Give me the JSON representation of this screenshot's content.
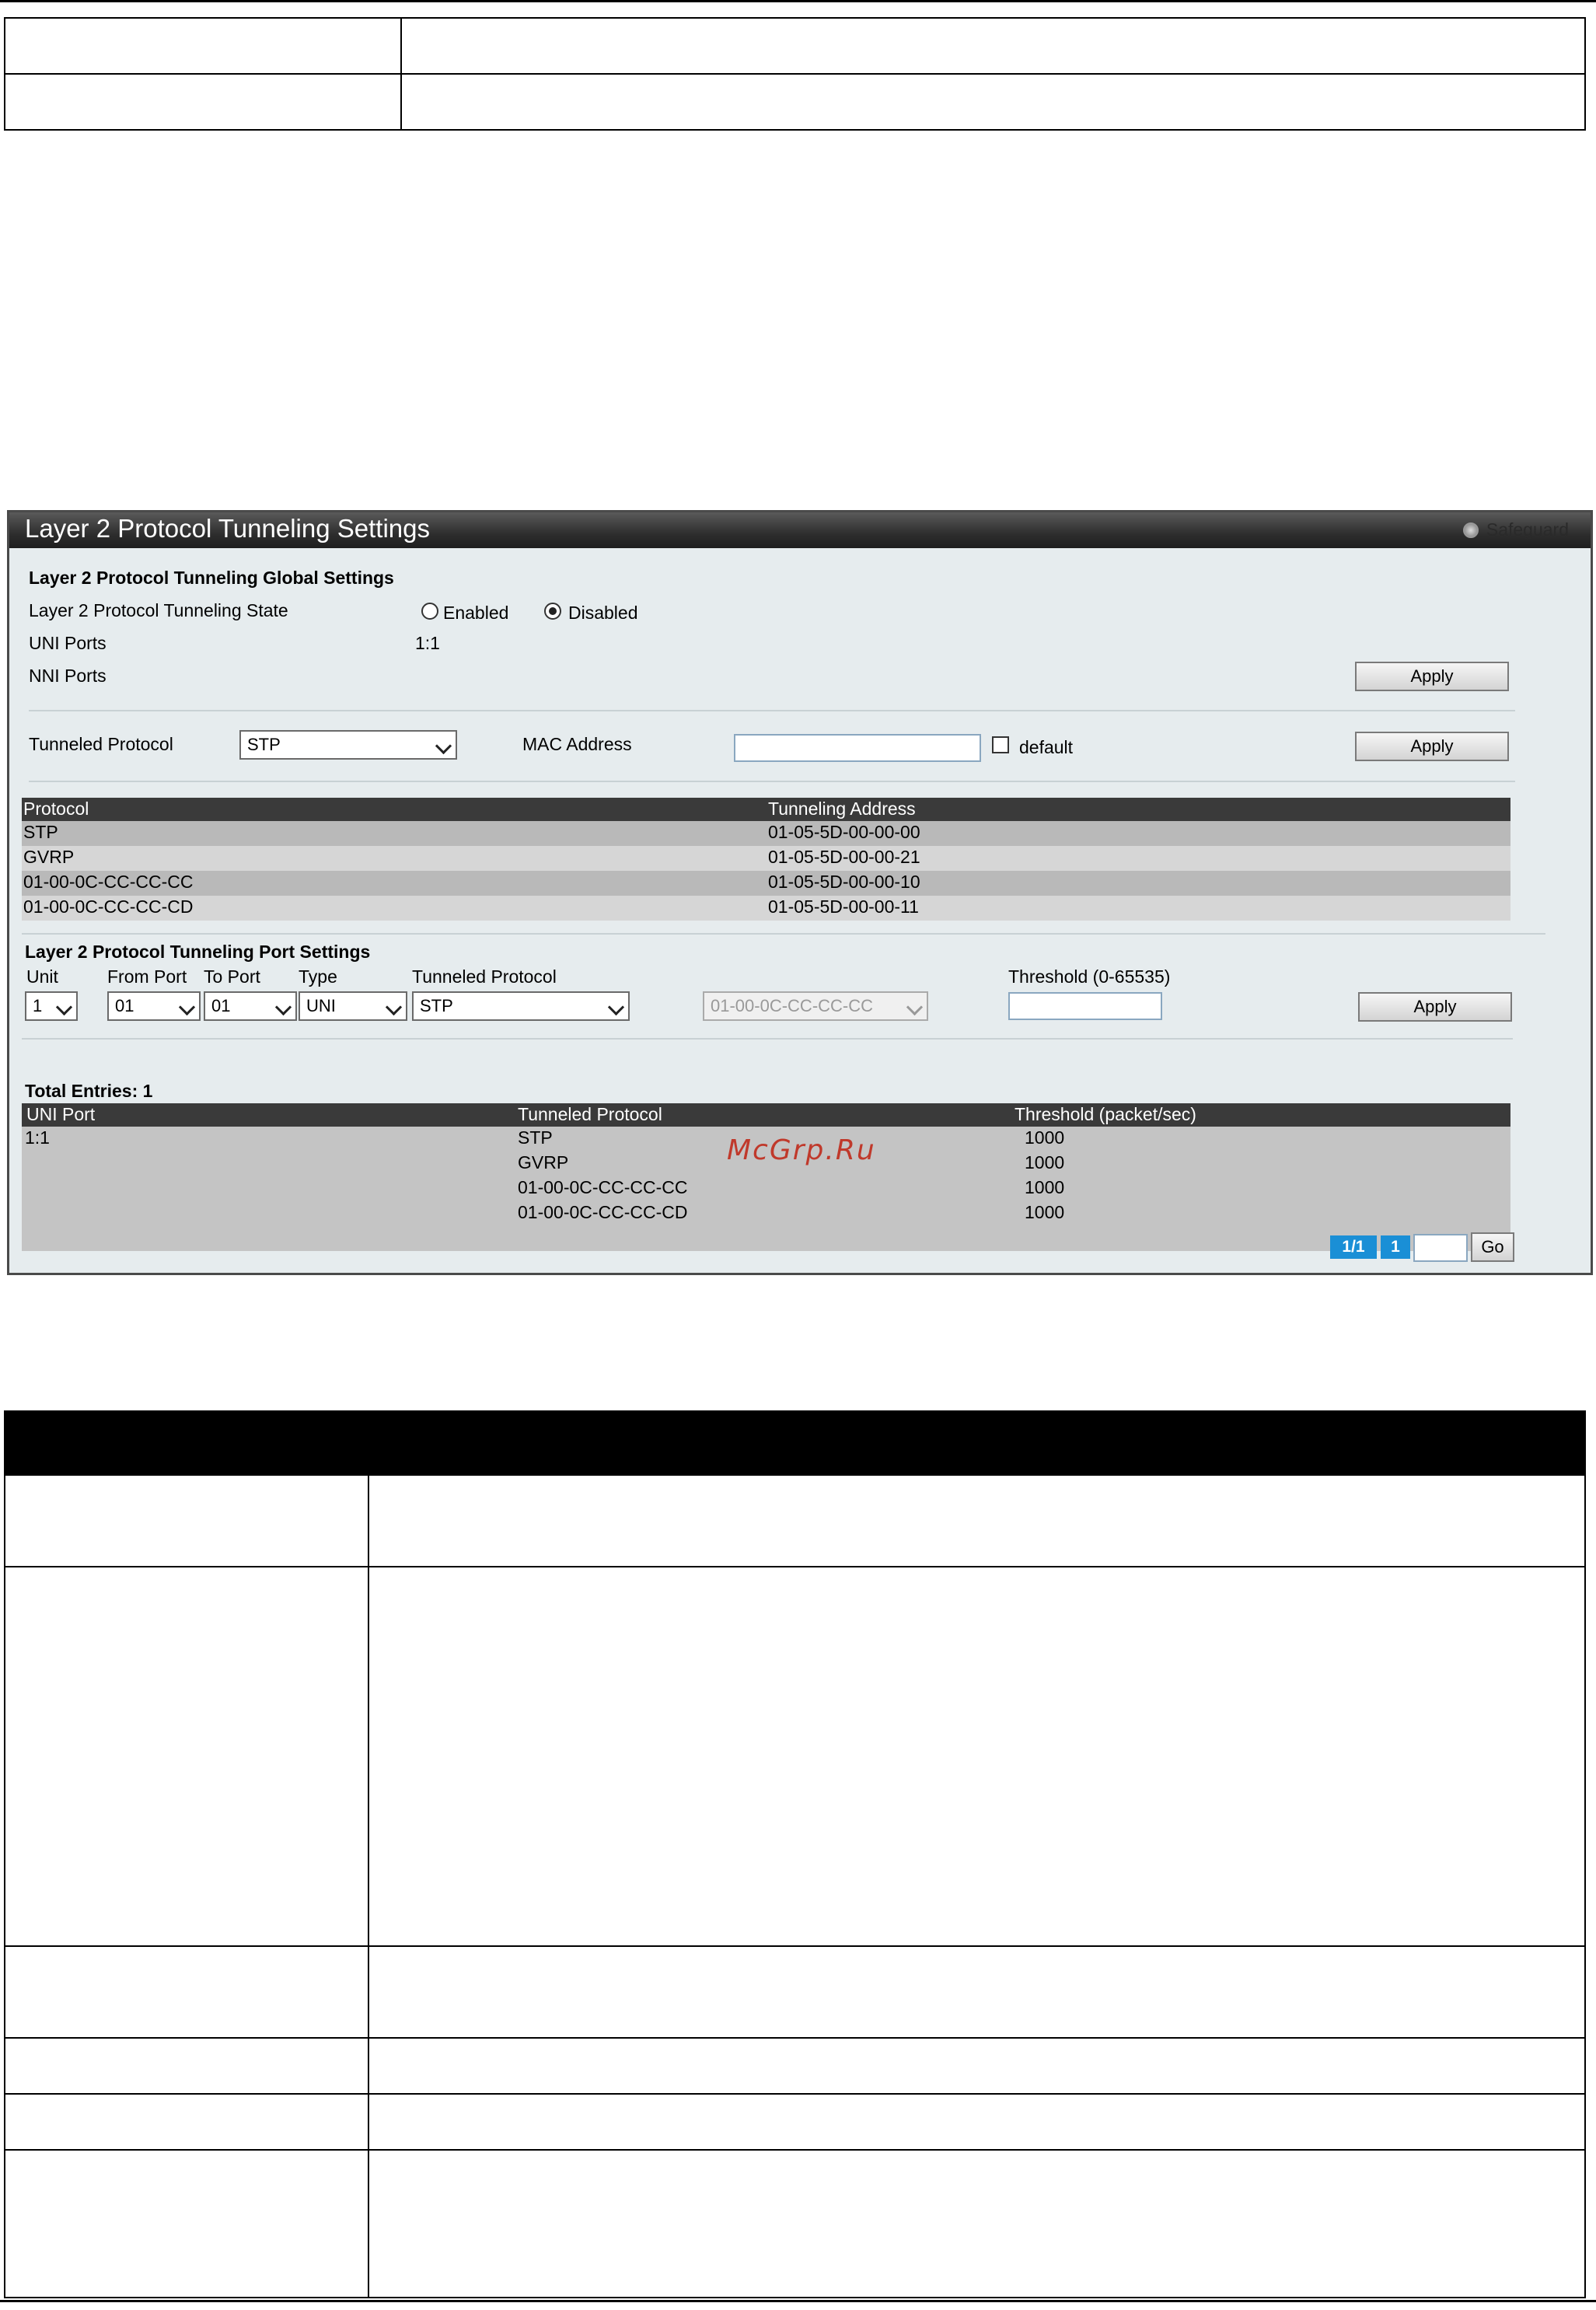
{
  "panel": {
    "title": "Layer 2 Protocol Tunneling Settings",
    "safeguard": "Safeguard"
  },
  "global": {
    "heading": "Layer 2 Protocol Tunneling Global Settings",
    "state_label": "Layer 2 Protocol Tunneling State",
    "enabled_label": "Enabled",
    "disabled_label": "Disabled",
    "selected_state": "Disabled",
    "uni_label": "UNI Ports",
    "uni_value": "1:1",
    "nni_label": "NNI Ports",
    "apply_label": "Apply"
  },
  "tunnel": {
    "protocol_label": "Tunneled Protocol",
    "protocol_value": "STP",
    "mac_label": "MAC Address",
    "mac_value": "",
    "default_label": "default",
    "apply_label": "Apply"
  },
  "protocol_table": {
    "headers": [
      "Protocol",
      "Tunneling Address"
    ],
    "rows": [
      [
        "STP",
        "01-05-5D-00-00-00"
      ],
      [
        "GVRP",
        "01-05-5D-00-00-21"
      ],
      [
        "01-00-0C-CC-CC-CC",
        "01-05-5D-00-00-10"
      ],
      [
        "01-00-0C-CC-CC-CD",
        "01-05-5D-00-00-11"
      ]
    ]
  },
  "port": {
    "heading": "Layer 2 Protocol Tunneling Port Settings",
    "unit_label": "Unit",
    "from_label": "From Port",
    "to_label": "To Port",
    "type_label": "Type",
    "protocol_label": "Tunneled Protocol",
    "threshold_label": "Threshold (0-65535)",
    "unit_value": "1",
    "from_value": "01",
    "to_value": "01",
    "type_value": "UNI",
    "protocol_value": "STP",
    "mac_value": "01-00-0C-CC-CC-CC",
    "threshold_value": "",
    "apply_label": "Apply"
  },
  "entries": {
    "total": "Total Entries: 1",
    "headers": [
      "UNI Port",
      "Tunneled Protocol",
      "Threshold (packet/sec)"
    ],
    "port": "1:1",
    "rows": [
      [
        "STP",
        "1000"
      ],
      [
        "GVRP",
        "1000"
      ],
      [
        "01-00-0C-CC-CC-CC",
        "1000"
      ],
      [
        "01-00-0C-CC-CC-CD",
        "1000"
      ]
    ]
  },
  "pager": {
    "pages": "1/1",
    "current": "1",
    "go_label": "Go",
    "input_value": ""
  },
  "watermark": "McGrp.Ru"
}
